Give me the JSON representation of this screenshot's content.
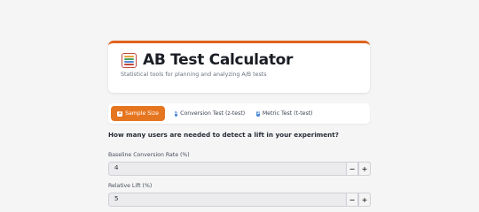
{
  "header": {
    "icon": "abacus-icon",
    "title": "AB Test Calculator",
    "subtitle": "Statistical tools for planning and analyzing A/B tests",
    "accent_color": "#e0631d"
  },
  "tabs": [
    {
      "number": "1",
      "label": "Sample Size",
      "active": true
    },
    {
      "number": "2",
      "label": "Conversion Test (z-test)",
      "active": false
    },
    {
      "number": "3",
      "label": "Metric Test (t-test)",
      "active": false
    }
  ],
  "question": "How many users are needed to detect a lift in your experiment?",
  "fields": [
    {
      "label": "Baseline Conversion Rate (%)",
      "value": "4"
    },
    {
      "label": "Relative Lift (%)",
      "value": "5"
    }
  ],
  "stepper": {
    "decrement": "−",
    "increment": "+"
  }
}
